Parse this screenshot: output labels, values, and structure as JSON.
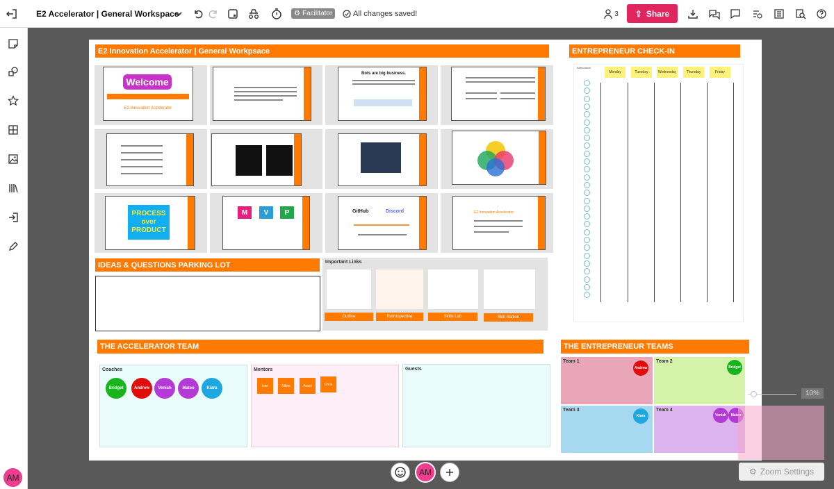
{
  "header": {
    "title": "E2 Accelerator | General Workspace",
    "facilitator": "Facilitator",
    "saved_status": "All changes saved!",
    "user_count": "3",
    "share_label": "Share"
  },
  "board": {
    "main_title": "E2 Innovation Accelerator | General Workpsace",
    "checkin_title": "ENTREPRENEUR CHECK-IN",
    "checkin_days": [
      "Monday",
      "Tuesday",
      "Wednesday",
      "Thursday",
      "Friday"
    ],
    "checkin_attendance": "Attendance",
    "parking_title": "IDEAS & QUESTIONS PARKING LOT",
    "links_title": "Important Links",
    "links": [
      "Outline",
      "Retrospective",
      "Skills Lab",
      "Skill Station"
    ],
    "team_title": "THE ACCELERATOR TEAM",
    "coaches_label": "Coaches",
    "coaches": [
      "Bridget",
      "Andrew",
      "Venish",
      "Mateo",
      "Kiara"
    ],
    "mentors_label": "Mentors",
    "mentors": [
      "Ivan",
      "Nikita",
      "Avani",
      "Chris"
    ],
    "guests_label": "Guests",
    "ent_teams_title": "THE ENTREPRENEUR TEAMS",
    "teams": [
      {
        "name": "Team 1",
        "member": "Andrew"
      },
      {
        "name": "Team 2",
        "member": "Bridget"
      },
      {
        "name": "Team 3",
        "member": "Kiara"
      },
      {
        "name": "Team 4",
        "member": "Venish",
        "member2": "Mateo"
      }
    ],
    "slides": {
      "welcome": "Welcome",
      "welcome_sub": "E2 Innovation Accelerator",
      "bots": "Bots are big business.",
      "process": "PROCESS over PRODUCT",
      "mvp": [
        "M",
        "V",
        "P"
      ],
      "github": "GitHub",
      "discord": "Discord",
      "slide_accel": "E2 Innovation Accelerator"
    }
  },
  "footer": {
    "zoom": "10%",
    "zoom_settings": "Zoom Settings",
    "avatar": "AM"
  },
  "colors": {
    "accent": "#ff7a00",
    "share": "#e0245e",
    "avatar": "#ee3d8e",
    "coaches": [
      "#19b31d",
      "#e00d0d",
      "#b33ad6",
      "#b33ad6",
      "#1fa7e0"
    ]
  }
}
